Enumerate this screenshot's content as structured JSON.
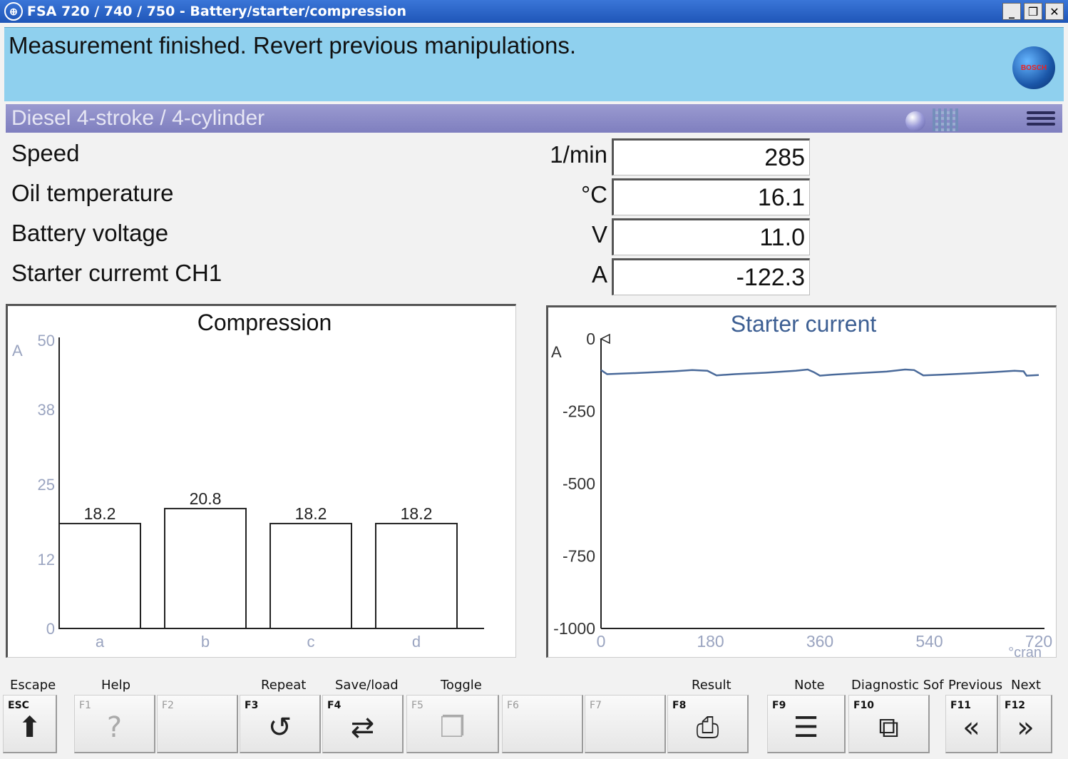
{
  "window": {
    "title": "FSA 720 / 740 / 750 - Battery/starter/compression",
    "minimize": "_",
    "restore": "❒",
    "close": "✕"
  },
  "message": "Measurement finished. Revert previous manipulations.",
  "logo_text": "BOSCH",
  "engine": "Diesel 4-stroke /  4-cylinder",
  "measurements": [
    {
      "label": "Speed",
      "unit": "1/min",
      "value": "285"
    },
    {
      "label": "Oil temperature",
      "unit": "°C",
      "value": "16.1"
    },
    {
      "label": "Battery voltage",
      "unit": "V",
      "value": "11.0"
    },
    {
      "label": "Starter curremt CH1",
      "unit": "A",
      "value": "-122.3"
    }
  ],
  "chart_data": [
    {
      "type": "bar",
      "title": "Compression",
      "ylabel": "A",
      "yticks": [
        0,
        12,
        25,
        38,
        50
      ],
      "ylim": [
        0,
        50
      ],
      "categories": [
        "a",
        "b",
        "c",
        "d"
      ],
      "values": [
        18.2,
        20.8,
        18.2,
        18.2
      ],
      "value_labels": [
        "18.2",
        "20.8",
        "18.2",
        "18.2"
      ],
      "title_color": "#111111",
      "axis_label_color": "#9aa4c0"
    },
    {
      "type": "line",
      "title": "Starter current",
      "ylabel": "A",
      "xlabel": "°cran",
      "yticks": [
        0,
        -250,
        -500,
        -750,
        -1000
      ],
      "ylim": [
        -1000,
        0
      ],
      "xticks": [
        0,
        180,
        360,
        540,
        720
      ],
      "xlim": [
        0,
        720
      ],
      "series": [
        {
          "x": [
            0,
            10,
            60,
            120,
            150,
            175,
            190,
            220,
            270,
            320,
            340,
            350,
            360,
            380,
            420,
            470,
            500,
            515,
            530,
            560,
            610,
            660,
            680,
            695,
            700,
            720
          ],
          "y": [
            -108,
            -122,
            -118,
            -112,
            -108,
            -110,
            -126,
            -122,
            -117,
            -110,
            -106,
            -115,
            -127,
            -124,
            -119,
            -113,
            -106,
            -108,
            -126,
            -124,
            -119,
            -113,
            -110,
            -112,
            -127,
            -125
          ]
        }
      ],
      "title_color": "#3d5f93",
      "line_color": "#4a6a9a",
      "axis_label_color": "#9aa4c0"
    }
  ],
  "function_keys": [
    {
      "label": "Escape",
      "code": "ESC",
      "glyph": "⬆",
      "enabled": true
    },
    {
      "label": "Help",
      "code": "F1",
      "glyph": "?",
      "enabled": false
    },
    {
      "label": "",
      "code": "F2",
      "glyph": "",
      "enabled": false
    },
    {
      "label": "Repeat",
      "code": "F3",
      "glyph": "↺",
      "enabled": true
    },
    {
      "label": "Save/load",
      "code": "F4",
      "glyph": "⇄",
      "enabled": true
    },
    {
      "label": "Toggle",
      "code": "F5",
      "glyph": "❐",
      "enabled": false
    },
    {
      "label": "",
      "code": "F6",
      "glyph": "",
      "enabled": false
    },
    {
      "label": "",
      "code": "F7",
      "glyph": "",
      "enabled": false
    },
    {
      "label": "Result",
      "code": "F8",
      "glyph": "⎙",
      "enabled": true
    },
    {
      "label": "Note",
      "code": "F9",
      "glyph": "☰",
      "enabled": true
    },
    {
      "label": "Diagnostic Sof",
      "code": "F10",
      "glyph": "⧉",
      "enabled": true
    },
    {
      "label": "Previous",
      "code": "F11",
      "glyph": "«",
      "enabled": true
    },
    {
      "label": "Next",
      "code": "F12",
      "glyph": "»",
      "enabled": true
    }
  ]
}
